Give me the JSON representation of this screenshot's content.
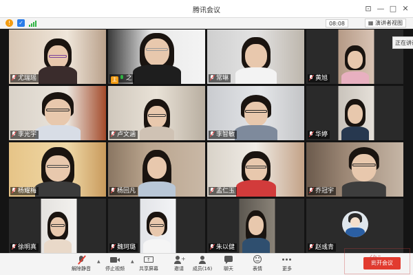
{
  "window": {
    "title": "腾讯会议"
  },
  "toolbar": {
    "time": "08:08",
    "view_button": "演讲者视图",
    "speaking_indicator": "正在讲话"
  },
  "participants": [
    {
      "name": "尤瑞瑶",
      "muted": true
    },
    {
      "name": "之",
      "muted": false,
      "host": true,
      "speaking": true
    },
    {
      "name": "常琳",
      "muted": true
    },
    {
      "name": "黄旭",
      "muted": true
    },
    {
      "name": "李光宇",
      "muted": true
    },
    {
      "name": "卢文涵",
      "muted": true
    },
    {
      "name": "李智敏",
      "muted": true
    },
    {
      "name": "华婷",
      "muted": true
    },
    {
      "name": "杨耀梅",
      "muted": true
    },
    {
      "name": "杨回凡",
      "muted": true
    },
    {
      "name": "孟仁玉",
      "muted": true
    },
    {
      "name": "乔冠宇",
      "muted": true
    },
    {
      "name": "徐明真",
      "muted": true
    },
    {
      "name": "魏珂璐",
      "muted": true
    },
    {
      "name": "朱以健",
      "muted": true
    },
    {
      "name": "赵彧青",
      "muted": true,
      "avatar_only": true
    }
  ],
  "bottombar": {
    "unmute": "解除静音",
    "stop_video": "停止视频",
    "share_screen": "共享屏幕",
    "invite": "邀请",
    "members": "成员(16)",
    "chat": "聊天",
    "reactions": "表情",
    "more": "更多",
    "leave": "离开会议"
  },
  "colors": {
    "accent": "#f2b51b",
    "leave": "#e23b2f",
    "muted": "#ff4d4f"
  }
}
